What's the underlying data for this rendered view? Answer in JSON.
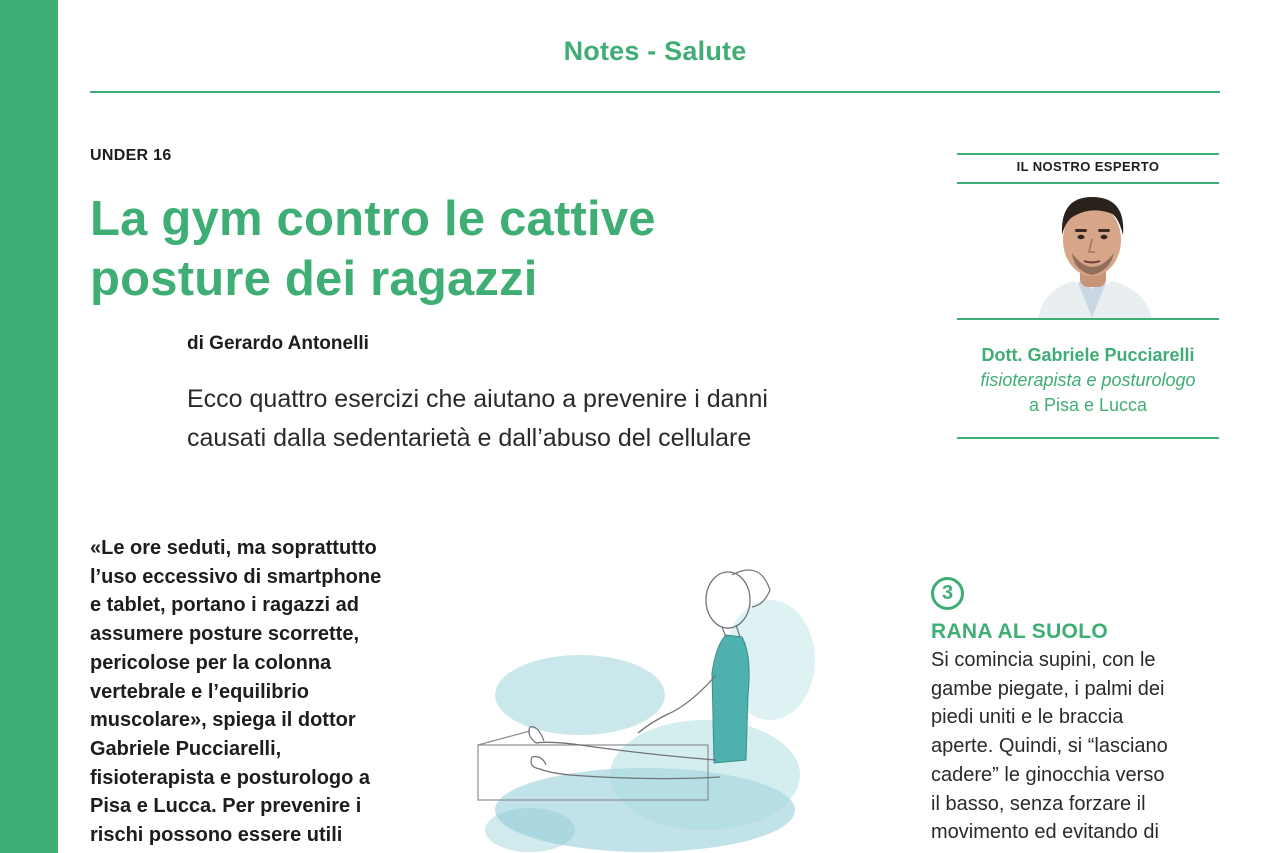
{
  "header": {
    "section": "Notes - Salute"
  },
  "article": {
    "kicker": "UNDER 16",
    "headline_line1": "La gym contro le cattive",
    "headline_line2": "posture dei ragazzi",
    "byline": "di Gerardo Antonelli",
    "standfirst_line1": "Ecco quattro esercizi che aiutano a prevenire i danni",
    "standfirst_line2": "causati dalla sedentarietà e dall’abuso del cellulare",
    "body_lines": [
      "«Le ore seduti, ma soprattutto",
      "l’uso eccessivo di smartphone",
      "e tablet, portano i ragazzi ad",
      "assumere posture scorrette,",
      "pericolose per la colonna",
      "vertebrale e l’equilibrio",
      "muscolare», spiega il dottor",
      "Gabriele Pucciarelli,",
      "fisioterapista e posturologo a",
      "Pisa e Lucca. Per prevenire i",
      "rischi possono essere utili"
    ]
  },
  "expert": {
    "label": "IL NOSTRO ESPERTO",
    "name": "Dott. Gabriele Pucciarelli",
    "role": "fisioterapista e posturologo",
    "place": "a Pisa e Lucca"
  },
  "exercise": {
    "number": "3",
    "title": "RANA AL SUOLO",
    "body_lines": [
      "Si comincia supini, con le",
      "gambe piegate, i palmi dei",
      "piedi uniti e le braccia",
      "aperte. Quindi, si “lasciano",
      "cadere” le ginocchia verso",
      "il basso, senza forzare il",
      "movimento ed evitando di"
    ]
  },
  "colors": {
    "accent": "#3fae74",
    "text": "#1d1d1b",
    "watercolor": "#7cc3cf"
  }
}
